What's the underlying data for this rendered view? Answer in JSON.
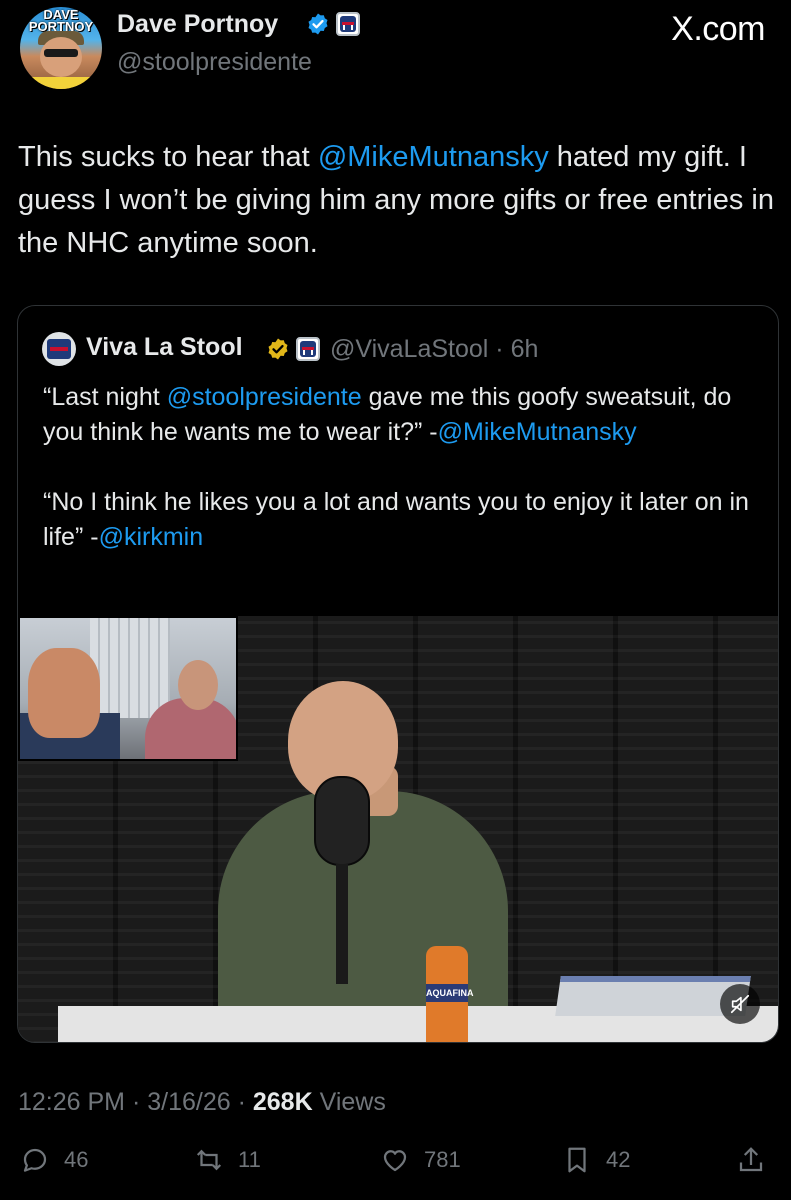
{
  "author": {
    "name": "Dave Portnoy",
    "handle": "@stoolpresidente",
    "avatar_text": "DAVE\nPORTNOY"
  },
  "site": "X.com",
  "tweet": {
    "part1": "This sucks to hear that ",
    "mention": "@MikeMutnansky",
    "part2": " hated my gift.   I guess I won’t be giving him any more gifts or free entries in the NHC anytime soon."
  },
  "quote": {
    "name": "Viva La Stool",
    "handle_time": "@VivaLaStool · 6h",
    "line1_a": "“Last night ",
    "line1_mention": "@stoolpresidente",
    "line1_b": " gave me this goofy sweatsuit, do you think he wants me to wear it?” -",
    "line1_mention2": "@MikeMutnansky",
    "line2_a": "“No I think he likes you a lot and wants you to enjoy it later on in life” -",
    "line2_mention": "@kirkmin",
    "media_bottle_label": "AQUAFINA"
  },
  "meta": {
    "time": "12:26 PM",
    "date": "3/16/26",
    "views_count": "268K",
    "views_label": "Views"
  },
  "actions": {
    "replies": "46",
    "reposts": "11",
    "likes": "781",
    "bookmarks": "42"
  },
  "colors": {
    "background": "#000000",
    "link": "#1d9bf0",
    "muted": "#71767b",
    "text": "#e7e9ea",
    "verified": "#1d9bf0"
  },
  "icons": [
    "verified-badge-icon",
    "barstool-badge-icon",
    "mute-icon",
    "reply-icon",
    "repost-icon",
    "like-icon",
    "bookmark-icon",
    "share-icon"
  ]
}
